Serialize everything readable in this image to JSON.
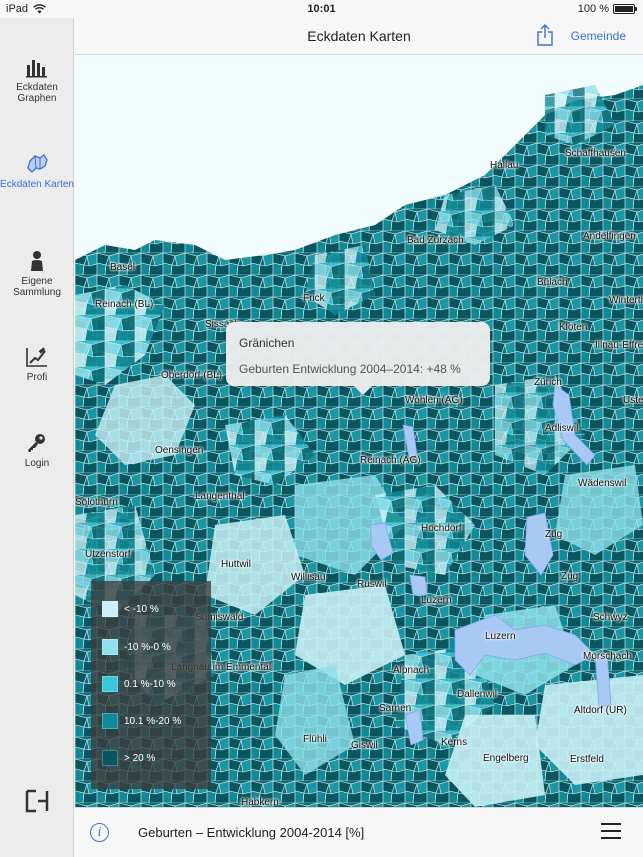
{
  "status": {
    "device": "iPad",
    "time": "10:01",
    "battery": "100 %"
  },
  "sidebar": {
    "items": [
      {
        "label": "Eckdaten Graphen",
        "icon": "bar-chart-icon"
      },
      {
        "label": "Eckdaten Karten",
        "icon": "map-icon",
        "active": true
      },
      {
        "label": "Eigene Sammlung",
        "icon": "person-icon"
      },
      {
        "label": "Profi",
        "icon": "profi-chart-icon"
      },
      {
        "label": "Login",
        "icon": "key-icon"
      }
    ]
  },
  "navbar": {
    "title": "Eckdaten Karten",
    "right_button": "Gemeinde",
    "share_icon": "share-icon"
  },
  "map": {
    "places": [
      "Hallau",
      "Schaffhausen",
      "Bad Zurzach",
      "Andelfingen",
      "Basel",
      "Bülach",
      "Winterthur",
      "Reinach (BL)",
      "Frick",
      "Kloten",
      "Illnau-Effretikon",
      "Sissach",
      "Oberdorf (BL)",
      "Zürich",
      "Uster",
      "Wohlen (AG)",
      "Adliswil",
      "Oensingen",
      "Reinach (AG)",
      "Wädenswil",
      "Solothurn",
      "Langenthal",
      "Hochdorf",
      "Zug",
      "Utzenstorf",
      "Huttwil",
      "Willisau",
      "Ruswil",
      "Zug",
      "Sumiswald",
      "Luzern",
      "Schwyz",
      "Luzern",
      "Langnau im Emmental",
      "Alpnach",
      "Morschach",
      "Dallenwil",
      "Sarnen",
      "Altdorf (UR)",
      "Flühli",
      "Giswil",
      "Kerns",
      "Engelberg",
      "Erstfeld",
      "Habkern"
    ]
  },
  "popup": {
    "title": "Gränichen",
    "text": "Geburten Entwicklung 2004–2014: +48 %"
  },
  "legend": {
    "items": [
      {
        "label": "< -10 %",
        "color": "#c8f0f6"
      },
      {
        "label": "-10 %-0 %",
        "color": "#8fe0ea"
      },
      {
        "label": "0.1 %-10 %",
        "color": "#3cc6d9"
      },
      {
        "label": "10.1 %-20 %",
        "color": "#108a96"
      },
      {
        "label": "> 20 %",
        "color": "#0a5660"
      }
    ]
  },
  "bottom": {
    "title": "Geburten – Entwicklung 2004-2014 [%]",
    "info_icon": "info-icon",
    "menu_icon": "hamburger-menu-icon"
  },
  "colors": {
    "accent": "#3b6fd4",
    "lake": "#a9c9f5"
  }
}
